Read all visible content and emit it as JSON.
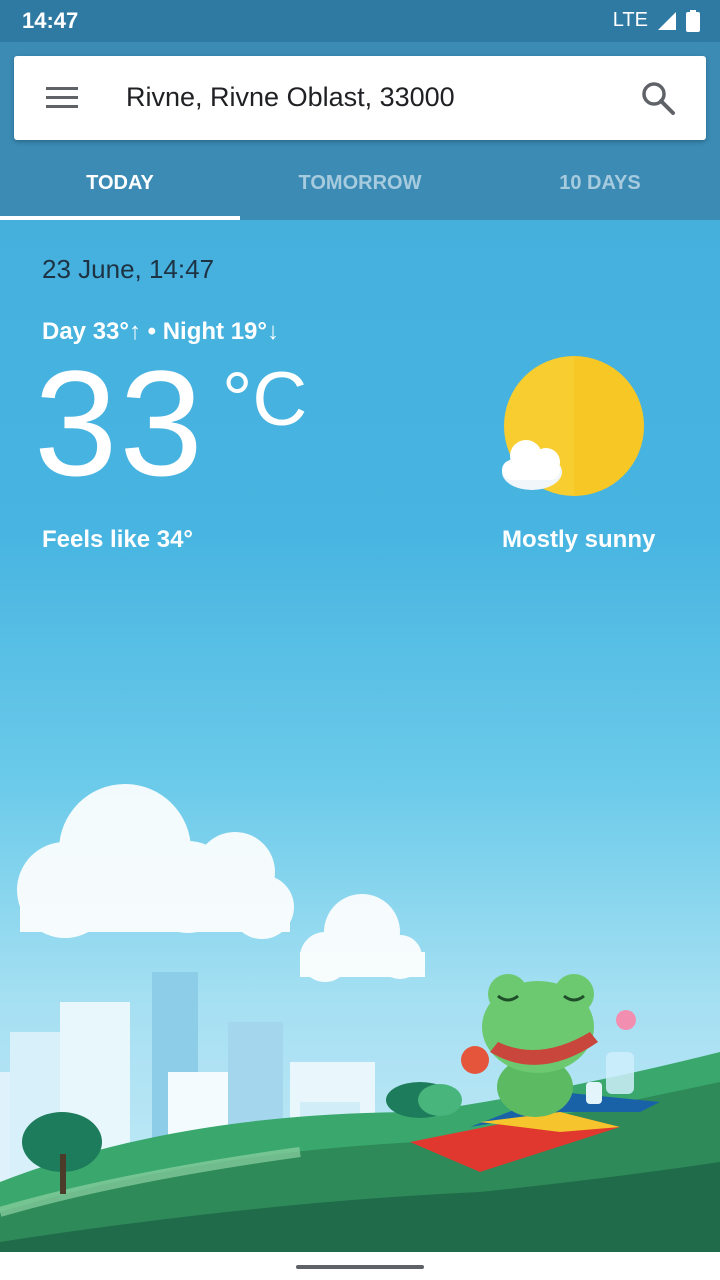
{
  "status_bar": {
    "time": "14:47",
    "network": "LTE"
  },
  "search": {
    "location": "Rivne, Rivne Oblast, 33000"
  },
  "tabs": [
    {
      "label": "TODAY",
      "active": true
    },
    {
      "label": "TOMORROW",
      "active": false
    },
    {
      "label": "10 DAYS",
      "active": false
    }
  ],
  "weather": {
    "datetime": "23 June, 14:47",
    "day_night": "Day 33°↑ • Night 19°↓",
    "temperature": "33",
    "unit": "°C",
    "feels_like": "Feels like 34°",
    "condition": "Mostly sunny",
    "icon": "sun-with-cloud-icon"
  },
  "colors": {
    "status_bar": "#2f7aa3",
    "header": "#3b8bb5",
    "sky_top": "#46b0dd",
    "sun": "#f8cd2f"
  }
}
